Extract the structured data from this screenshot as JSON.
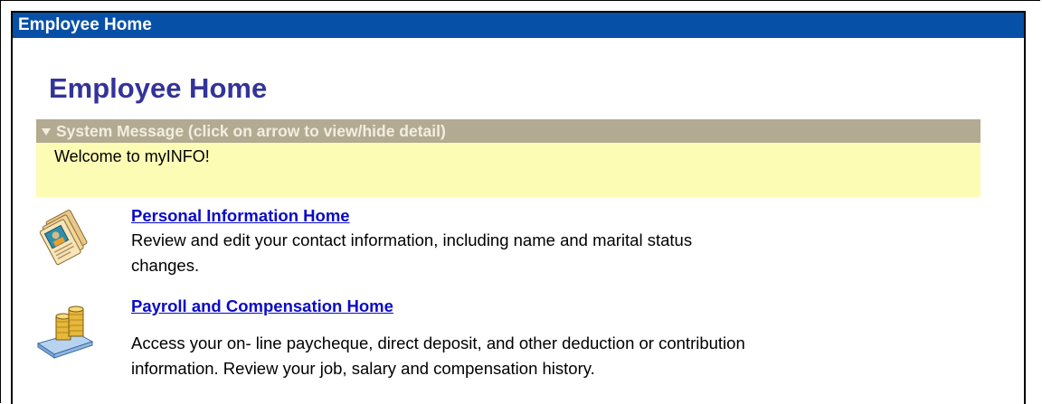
{
  "window": {
    "title": "Employee Home"
  },
  "page": {
    "title": "Employee Home"
  },
  "system_message": {
    "header": "System Message (click on arrow to view/hide detail)",
    "body": "Welcome to myINFO!"
  },
  "items": [
    {
      "link": "Personal Information Home",
      "desc_line1": "Review and edit your contact information, including name and marital status",
      "desc_line2": "changes.",
      "icon": "personal-info-icon"
    },
    {
      "link": "Payroll and Compensation Home",
      "desc_line1": "Access your on- line paycheque, direct deposit, and other deduction or contribution",
      "desc_line2": "information.  Review your job, salary and compensation history.",
      "icon": "payroll-coins-icon"
    }
  ],
  "colors": {
    "titlebar": "#0650a7",
    "page_title": "#333399",
    "message_header": "#b3aa92",
    "message_body": "#fcfcb5",
    "link": "#0a0ac8"
  }
}
